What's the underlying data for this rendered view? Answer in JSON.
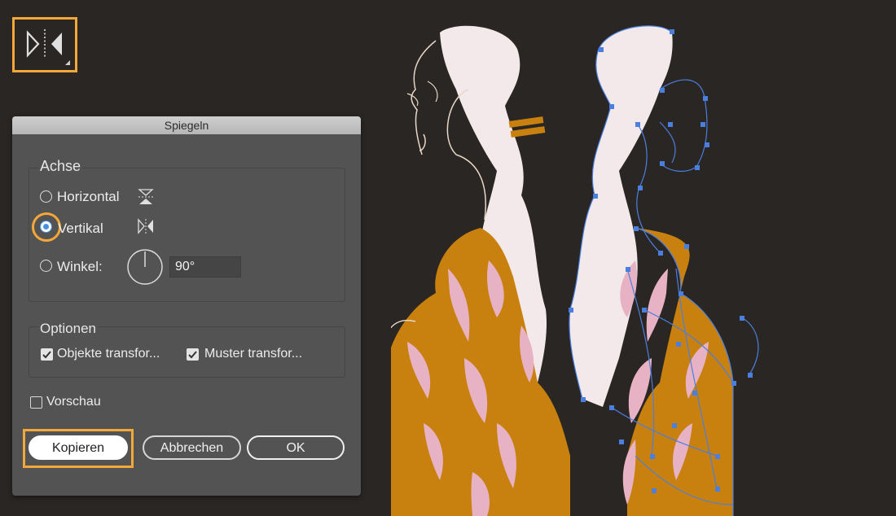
{
  "tool": {
    "icon": "reflect-tool-icon"
  },
  "dialog": {
    "title": "Spiegeln",
    "axis": {
      "legend": "Achse",
      "horizontal_label": "Horizontal",
      "vertical_label": "Vertikal",
      "angle_label": "Winkel:",
      "angle_value": "90°",
      "selected": "vertical"
    },
    "options": {
      "legend": "Optionen",
      "transform_objects_label": "Objekte transfor...",
      "transform_patterns_label": "Muster transfor...",
      "transform_objects_checked": true,
      "transform_patterns_checked": true
    },
    "preview_label": "Vorschau",
    "preview_checked": false,
    "buttons": {
      "copy": "Kopieren",
      "cancel": "Abbrechen",
      "ok": "OK"
    }
  },
  "colors": {
    "accent": "#f4a83a",
    "selection": "#4a7fe0",
    "mustard": "#c8800f",
    "pink": "#e7b3c4"
  }
}
